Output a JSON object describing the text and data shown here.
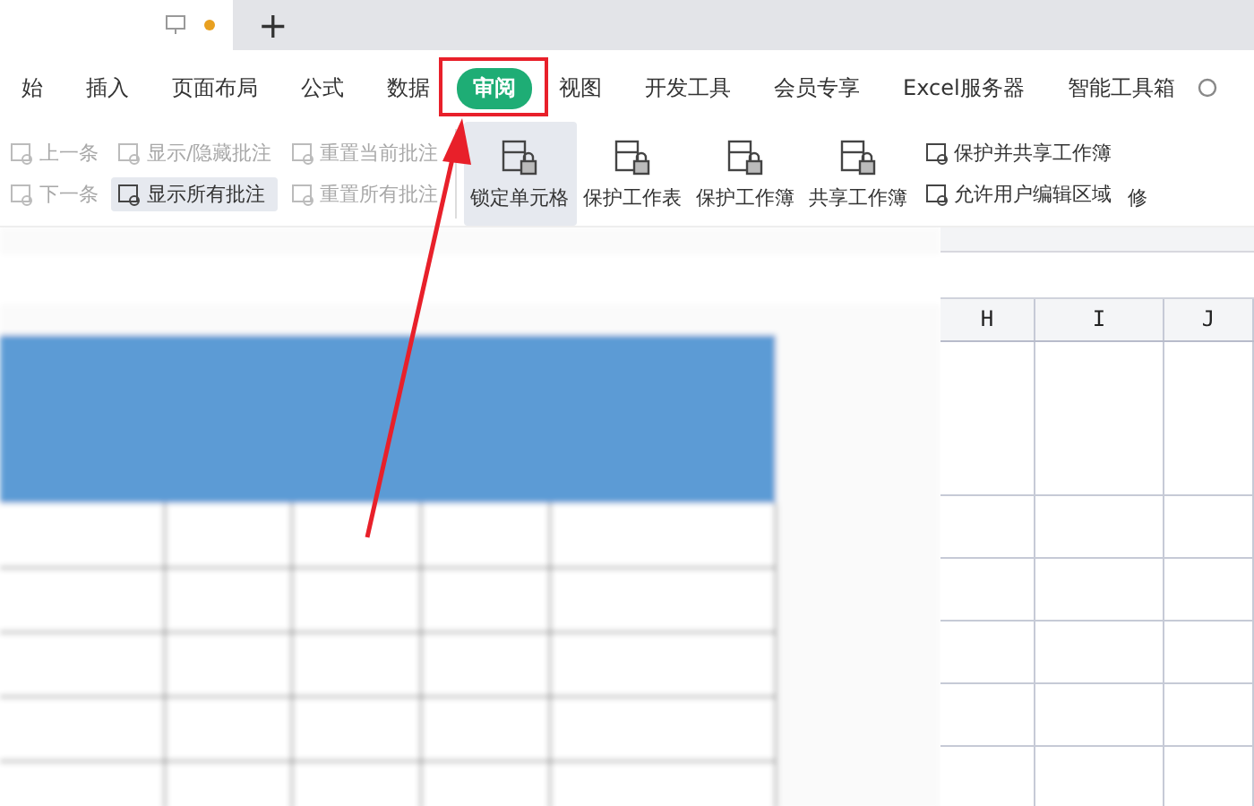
{
  "tab_bar": {
    "new_tab": "+",
    "unsaved": true
  },
  "menu": [
    {
      "label": "始",
      "selected": false
    },
    {
      "label": "插入",
      "selected": false
    },
    {
      "label": "页面布局",
      "selected": false
    },
    {
      "label": "公式",
      "selected": false
    },
    {
      "label": "数据",
      "selected": false
    },
    {
      "label": "审阅",
      "selected": true
    },
    {
      "label": "视图",
      "selected": false
    },
    {
      "label": "开发工具",
      "selected": false
    },
    {
      "label": "会员专享",
      "selected": false
    },
    {
      "label": "Excel服务器",
      "selected": false
    },
    {
      "label": "智能工具箱",
      "selected": false
    }
  ],
  "ribbon": {
    "small_columns": [
      [
        {
          "label": "上一条",
          "disabled": true,
          "selected": false
        },
        {
          "label": "下一条",
          "disabled": true,
          "selected": false
        }
      ],
      [
        {
          "label": "显示/隐藏批注",
          "disabled": true,
          "selected": false
        },
        {
          "label": "显示所有批注",
          "disabled": false,
          "selected": true
        }
      ],
      [
        {
          "label": "重置当前批注",
          "disabled": true,
          "selected": false
        },
        {
          "label": "重置所有批注",
          "disabled": true,
          "selected": false
        }
      ]
    ],
    "large_buttons": [
      {
        "label": "锁定单元格",
        "selected": true
      },
      {
        "label": "保护工作表",
        "selected": false
      },
      {
        "label": "保护工作簿",
        "selected": false
      },
      {
        "label": "共享工作簿",
        "selected": false
      }
    ],
    "right_column": [
      {
        "label": "保护并共享工作簿"
      },
      {
        "label": "允许用户编辑区域"
      }
    ],
    "cut_off": "修"
  },
  "sheet": {
    "columns": [
      "H",
      "I",
      "J"
    ]
  }
}
